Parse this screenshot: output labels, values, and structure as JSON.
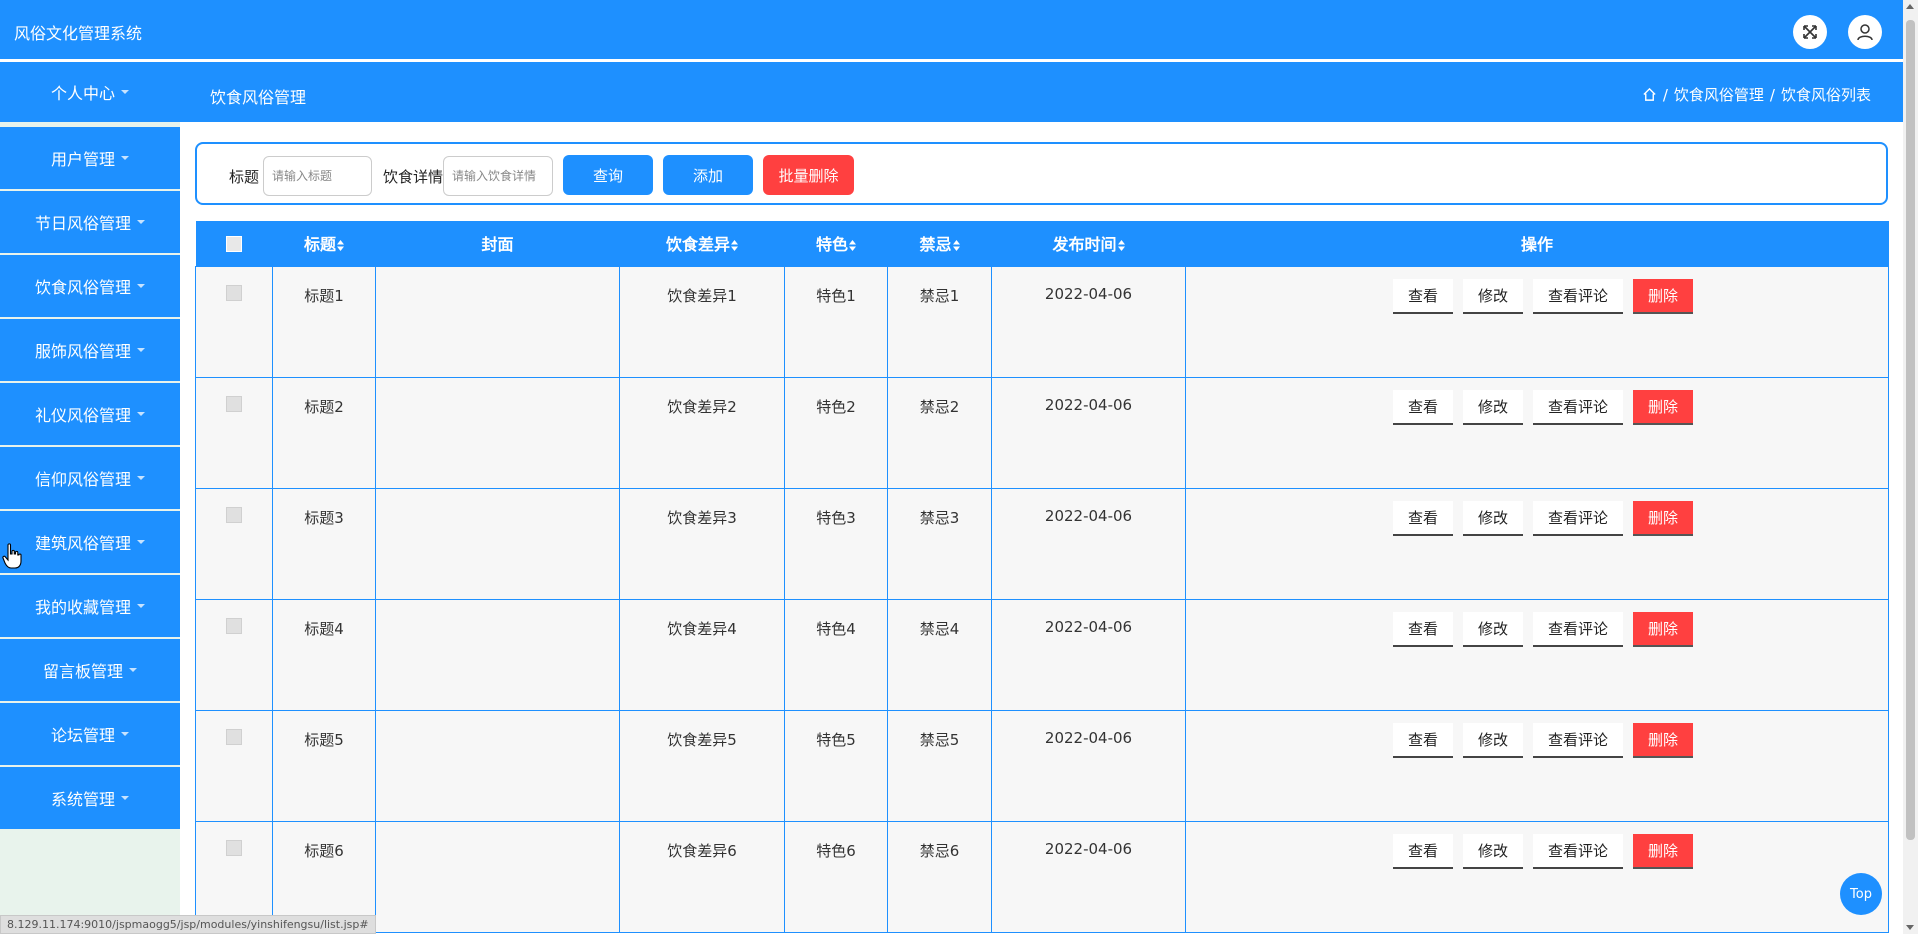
{
  "app": {
    "title": "风俗文化管理系统"
  },
  "colors": {
    "primary": "#1e90ff",
    "danger": "#ff4040",
    "sidebar_bg": "#e8f3ec",
    "row_bg": "#f7f7f7"
  },
  "topbar": {
    "icons": [
      "fullscreen-icon",
      "user-icon"
    ]
  },
  "subbar": {
    "menu_top": "个人中心",
    "page_heading": "饮食风俗管理",
    "breadcrumb": {
      "sep": "/",
      "items": [
        "饮食风俗管理",
        "饮食风俗列表"
      ]
    }
  },
  "sidebar": {
    "items": [
      {
        "label": "用户管理"
      },
      {
        "label": "节日风俗管理"
      },
      {
        "label": "饮食风俗管理"
      },
      {
        "label": "服饰风俗管理"
      },
      {
        "label": "礼仪风俗管理"
      },
      {
        "label": "信仰风俗管理"
      },
      {
        "label": "建筑风俗管理"
      },
      {
        "label": "我的收藏管理"
      },
      {
        "label": "留言板管理"
      },
      {
        "label": "论坛管理"
      },
      {
        "label": "系统管理"
      }
    ]
  },
  "search": {
    "title_label": "标题",
    "title_placeholder": "请输入标题",
    "detail_label": "饮食详情",
    "detail_placeholder": "请输入饮食详情",
    "query_btn": "查询",
    "add_btn": "添加",
    "batch_delete_btn": "批量删除"
  },
  "table": {
    "headers": {
      "title": "标题",
      "cover": "封面",
      "diff": "饮食差异",
      "feature": "特色",
      "taboo": "禁忌",
      "time": "发布时间",
      "ops": "操作"
    },
    "actions": {
      "view": "查看",
      "edit": "修改",
      "comments": "查看评论",
      "delete": "删除"
    },
    "rows": [
      {
        "title": "标题1",
        "cover": "",
        "diff": "饮食差异1",
        "feature": "特色1",
        "taboo": "禁忌1",
        "time": "2022-04-06"
      },
      {
        "title": "标题2",
        "cover": "",
        "diff": "饮食差异2",
        "feature": "特色2",
        "taboo": "禁忌2",
        "time": "2022-04-06"
      },
      {
        "title": "标题3",
        "cover": "",
        "diff": "饮食差异3",
        "feature": "特色3",
        "taboo": "禁忌3",
        "time": "2022-04-06"
      },
      {
        "title": "标题4",
        "cover": "",
        "diff": "饮食差异4",
        "feature": "特色4",
        "taboo": "禁忌4",
        "time": "2022-04-06"
      },
      {
        "title": "标题5",
        "cover": "",
        "diff": "饮食差异5",
        "feature": "特色5",
        "taboo": "禁忌5",
        "time": "2022-04-06"
      },
      {
        "title": "标题6",
        "cover": "",
        "diff": "饮食差异6",
        "feature": "特色6",
        "taboo": "禁忌6",
        "time": "2022-04-06"
      }
    ]
  },
  "float_top": "Top",
  "status_url": "8.129.11.174:9010/jspmaogg5/jsp/modules/yinshifengsu/list.jsp#"
}
